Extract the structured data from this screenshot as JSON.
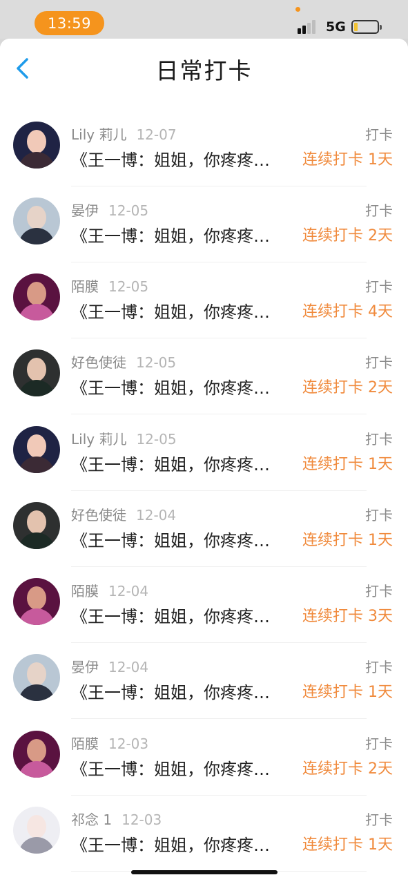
{
  "status_bar": {
    "time": "13:59",
    "network": "5G"
  },
  "header": {
    "title": "日常打卡"
  },
  "entries": [
    {
      "user": "",
      "date": "",
      "tag": "",
      "content": "《王一博：姐姐，你疼疼",
      "streak": "连续打卡 1天",
      "avatar": "pink-girl"
    },
    {
      "user": "Lily 莉儿",
      "date": "12-07",
      "tag": "打卡",
      "content": "《王一博：姐姐，你疼疼…",
      "streak": "连续打卡 1天",
      "avatar": "lily"
    },
    {
      "user": "晏伊",
      "date": "12-05",
      "tag": "打卡",
      "content": "《王一博：姐姐，你疼疼…",
      "streak": "连续打卡 2天",
      "avatar": "yanyi"
    },
    {
      "user": "陌膜",
      "date": "12-05",
      "tag": "打卡",
      "content": "《王一博：姐姐，你疼疼…",
      "streak": "连续打卡 4天",
      "avatar": "momo"
    },
    {
      "user": "好色使徒",
      "date": "12-05",
      "tag": "打卡",
      "content": "《王一博：姐姐，你疼疼…",
      "streak": "连续打卡 2天",
      "avatar": "haose"
    },
    {
      "user": "Lily 莉儿",
      "date": "12-05",
      "tag": "打卡",
      "content": "《王一博：姐姐，你疼疼…",
      "streak": "连续打卡 1天",
      "avatar": "lily"
    },
    {
      "user": "好色使徒",
      "date": "12-04",
      "tag": "打卡",
      "content": "《王一博：姐姐，你疼疼…",
      "streak": "连续打卡 1天",
      "avatar": "haose"
    },
    {
      "user": "陌膜",
      "date": "12-04",
      "tag": "打卡",
      "content": "《王一博：姐姐，你疼疼…",
      "streak": "连续打卡 3天",
      "avatar": "momo"
    },
    {
      "user": "晏伊",
      "date": "12-04",
      "tag": "打卡",
      "content": "《王一博：姐姐，你疼疼…",
      "streak": "连续打卡 1天",
      "avatar": "yanyi"
    },
    {
      "user": "陌膜",
      "date": "12-03",
      "tag": "打卡",
      "content": "《王一博：姐姐，你疼疼…",
      "streak": "连续打卡 2天",
      "avatar": "momo"
    },
    {
      "user": "祁念 1",
      "date": "12-03",
      "tag": "打卡",
      "content": "《王一博：姐姐，你疼疼…",
      "streak": "连续打卡 1天",
      "avatar": "anime"
    }
  ],
  "colors": {
    "accent_orange": "#f5941d",
    "streak_orange": "#f08a3c",
    "back_blue": "#1e9bea"
  }
}
